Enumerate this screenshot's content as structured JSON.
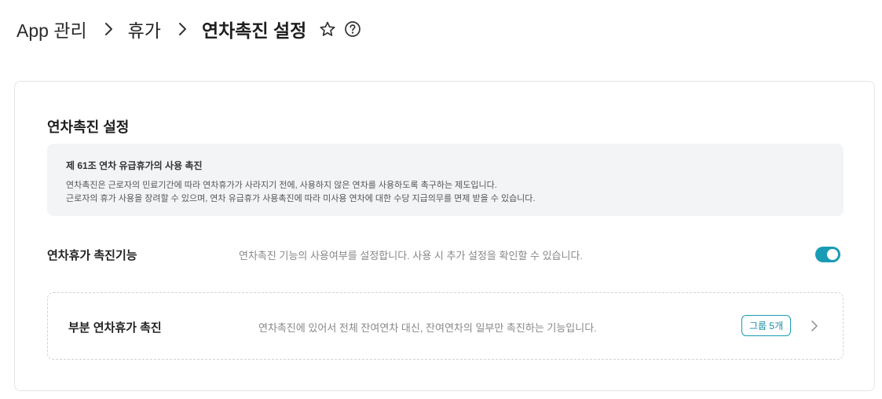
{
  "breadcrumb": {
    "items": [
      "App 관리",
      "휴가",
      "연차촉진 설정"
    ]
  },
  "card": {
    "title": "연차촉진 설정",
    "info": {
      "title": "제 61조 연차 유급휴가의 사용 촉진",
      "lines": [
        "연차촉진은 근로자의 민료기간에 따라 연차휴가가 사라지기 전에, 사용하지 않은 연차를 사용하도록 촉구하는 제도입니다.",
        "근로자의 휴가 사용을 장려할 수 있으며, 연차 유급휴가 사용촉진에 따라 미사용 연차에 대한 수당 지급의무를 면제 받을 수 있습니다."
      ]
    },
    "feature": {
      "label": "연차휴가 촉진기능",
      "description": "연차촉진 기능의 사용여부를 설정합니다. 사용 시 추가 설정을 확인할 수 있습니다.",
      "enabled": true
    },
    "partial": {
      "label": "부분 연차휴가 촉진",
      "description": "연차촉진에 있어서 전체 잔여연차 대신, 잔여연차의 일부만 촉진하는 기능입니다.",
      "badge": "그룹 5개"
    }
  },
  "colors": {
    "accent": "#1a9bb5",
    "info_bg": "#f3f4f6"
  },
  "icons": [
    "chevron-right-icon",
    "star-icon",
    "help-icon",
    "toggle-switch"
  ]
}
